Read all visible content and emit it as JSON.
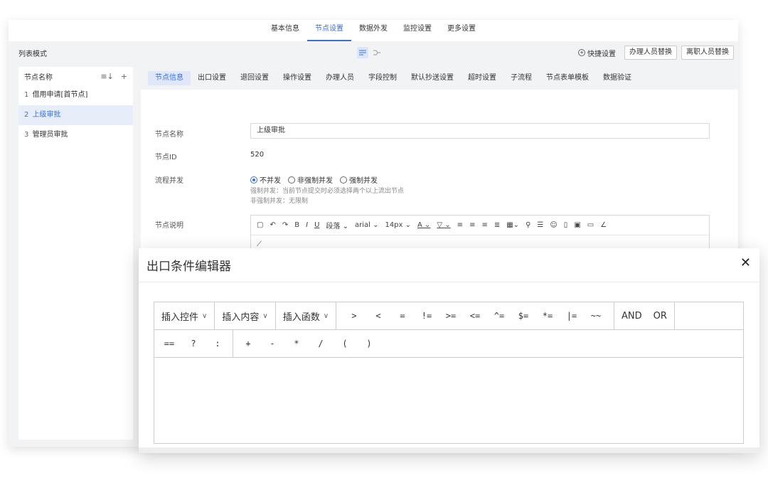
{
  "top_tabs": [
    "基本信息",
    "节点设置",
    "数据外发",
    "监控设置",
    "更多设置"
  ],
  "top_tab_active": 1,
  "mode_bar": {
    "label": "列表模式",
    "quick_settings": "快捷设置",
    "replace_handler": "办理人员替换",
    "replace_resigned": "离职人员替换"
  },
  "sidebar": {
    "header": "节点名称",
    "sort_icon": "sort-icon",
    "add_icon": "plus-icon",
    "nodes": [
      {
        "num": "1",
        "name": "借用申请[首节点]"
      },
      {
        "num": "2",
        "name": "上级审批"
      },
      {
        "num": "3",
        "name": "管理员审批"
      }
    ],
    "active_index": 1
  },
  "sub_tabs": [
    "节点信息",
    "出口设置",
    "退回设置",
    "操作设置",
    "办理人员",
    "字段控制",
    "默认抄送设置",
    "超时设置",
    "子流程",
    "节点表单模板",
    "数据验证"
  ],
  "form": {
    "node_name_label": "节点名称",
    "node_name_value": "上级审批",
    "node_id_label": "节点ID",
    "node_id_value": "520",
    "concurrency_label": "流程并发",
    "radio_options": [
      "不并发",
      "非强制并发",
      "强制并发"
    ],
    "radio_selected": 0,
    "hint1": "强制并发：当前节点提交时必须选择两个以上流出节点",
    "hint2": "非强制并发：无限制",
    "description_label": "节点说明"
  },
  "editor_toolbar": {
    "paragraph": "段落",
    "font": "arial",
    "size": "14px"
  },
  "modal": {
    "title": "出口条件编辑器",
    "dropdowns": [
      "插入控件",
      "插入内容",
      "插入函数"
    ],
    "operators": [
      ">",
      "<",
      "=",
      "!=",
      ">=",
      "<=",
      "^=",
      "$=",
      "*=",
      "|=",
      "~~"
    ],
    "logic": [
      "AND",
      "OR"
    ],
    "row2_ops_a": [
      "==",
      "?",
      ":"
    ],
    "row2_ops_b": [
      "+",
      "-",
      "*",
      "/",
      "(",
      ")"
    ]
  },
  "colors": {
    "accent": "#3b6fd8",
    "active_bg": "#e8eef9"
  }
}
